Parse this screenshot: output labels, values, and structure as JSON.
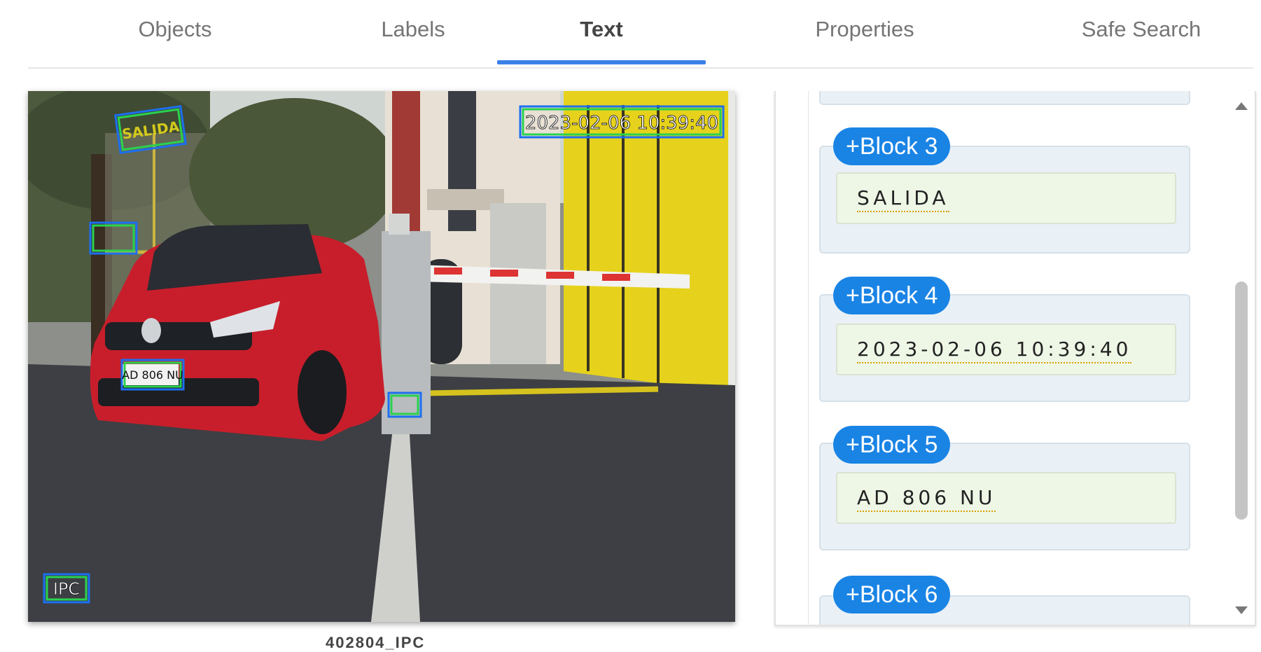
{
  "tabs": [
    {
      "label": "Objects"
    },
    {
      "label": "Labels"
    },
    {
      "label": "Text"
    },
    {
      "label": "Properties"
    },
    {
      "label": "Safe Search"
    }
  ],
  "active_tab": "Text",
  "image": {
    "overlay_texts": {
      "timestamp": "2023-02-06 10:39:40",
      "sign": "SALIDA",
      "plate": "AD 806 NU",
      "watermark": "IPC"
    },
    "caption": "402804_IPC"
  },
  "blocks": [
    {
      "badge": "+Block 3",
      "text": "SALIDA"
    },
    {
      "badge": "+Block 4",
      "text": "2023-02-06 10:39:40"
    },
    {
      "badge": "+Block 5",
      "text": "AD 806 NU"
    },
    {
      "badge": "+Block 6",
      "text": ""
    }
  ],
  "colors": {
    "accent": "#3b80e8",
    "badge": "#1a84e5",
    "ocr_box": "#22c94a"
  }
}
